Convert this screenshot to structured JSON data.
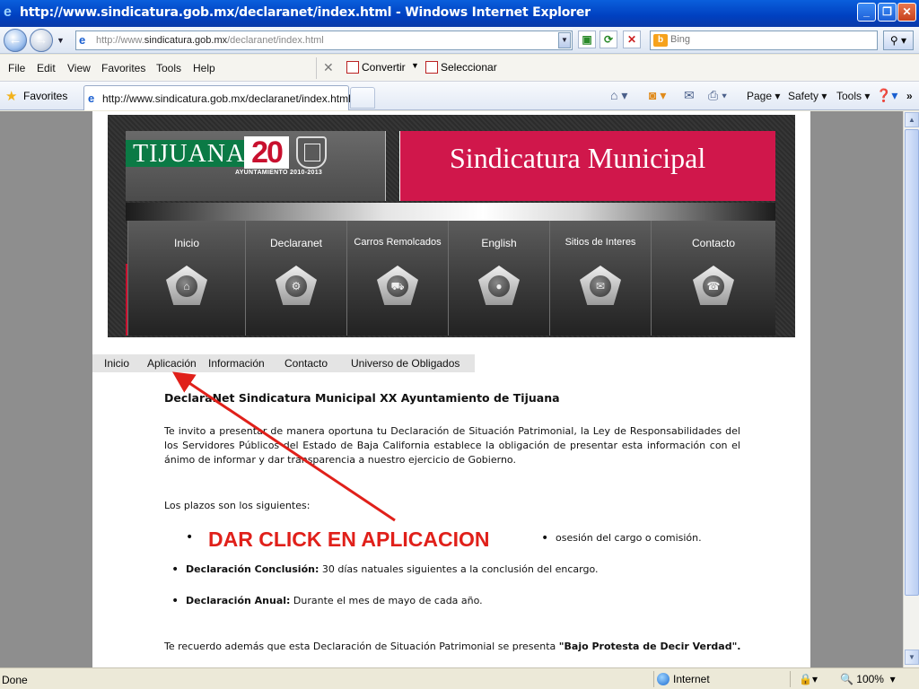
{
  "window": {
    "title": "http://www.sindicatura.gob.mx/declaranet/index.html - Windows Internet Explorer",
    "minimize": "_",
    "restore": "❐",
    "close": "✕"
  },
  "address": {
    "url_prefix": "http://www.",
    "url_domain": "sindicatura.gob.mx",
    "url_path": "/declaranet/index.html",
    "search_placeholder": "Bing"
  },
  "menu": {
    "items": [
      "File",
      "Edit",
      "View",
      "Favorites",
      "Tools",
      "Help"
    ],
    "convertir": "Convertir",
    "seleccionar": "Seleccionar"
  },
  "favorites_bar": {
    "favorites_label": "Favorites",
    "tab_label": "http://www.sindicatura.gob.mx/declaranet/index.html",
    "commands": [
      "Page ▾",
      "Safety ▾",
      "Tools ▾"
    ]
  },
  "site": {
    "logo_text": "TIJUANA",
    "logo_number": "20",
    "logo_subtitle": "AYUNTAMIENTO  2010-2013",
    "banner_title": "Sindicatura Municipal",
    "nav": [
      {
        "label": "Inicio",
        "glyph": "⌂"
      },
      {
        "label": "Declaranet",
        "glyph": "⚙"
      },
      {
        "label": "Carros Remolcados",
        "glyph": "⛟"
      },
      {
        "label": "English",
        "glyph": "●"
      },
      {
        "label": "Sitios de Interes",
        "glyph": "✉"
      },
      {
        "label": "Contacto",
        "glyph": "☎"
      }
    ],
    "menu": [
      "Inicio",
      "Aplicación",
      "Información",
      "Contacto",
      "Universo de Obligados"
    ]
  },
  "content": {
    "heading": "DeclaraNet Sindicatura Municipal XX Ayuntamiento de Tijuana",
    "intro": "Te invito a presentar de manera oportuna tu Declaración de Situación Patrimonial, la Ley de Responsabilidades del los Servidores Públicos del Estado de Baja California establece la obligación de presentar esta información con el ánimo de informar y dar transparencia a nuestro ejercicio de Gobierno.",
    "plazos": "Los plazos son los siguientes:",
    "bullet1_tail": "osesión del cargo o comisión.",
    "bullet2_label": "Declaración Conclusión:",
    "bullet2_text": " 30 días natuales siguientes a la conclusión del encargo.",
    "bullet3_label": "Declaración Anual:",
    "bullet3_text": " Durante el mes de mayo de cada año.",
    "footer_text": "Te recuerdo además que esta Declaración de Situación Patrimonial se presenta ",
    "footer_bold": "\"Bajo Protesta de Decir Verdad\"."
  },
  "annotation": {
    "text": "DAR CLICK EN APLICACION",
    "color": "#e0201a"
  },
  "status": {
    "done": "Done",
    "zone": "Internet",
    "zoom": "100%"
  }
}
